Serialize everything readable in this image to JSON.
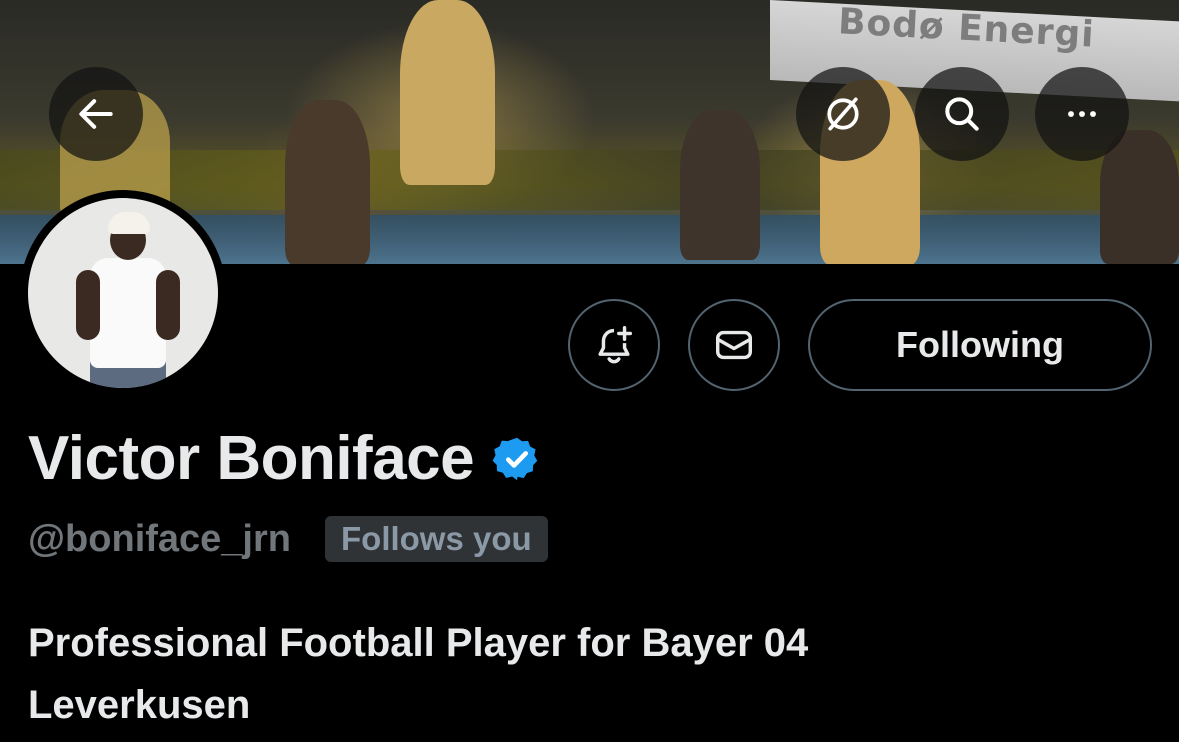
{
  "banner": {
    "ad_text": "Bodø Energi"
  },
  "header": {
    "back_icon": "arrow-left-icon",
    "translate_icon": "translate-slash-icon",
    "search_icon": "search-icon",
    "more_icon": "ellipsis-icon"
  },
  "profile": {
    "name": "Victor Boniface",
    "verified": true,
    "verified_color": "#1d9bf0",
    "handle": "@boniface_jrn",
    "follows_you_label": "Follows you",
    "bio": "Professional Football Player for Bayer 04 Leverkusen"
  },
  "actions": {
    "notify_icon": "bell-plus-icon",
    "message_icon": "envelope-icon",
    "following_label": "Following"
  }
}
